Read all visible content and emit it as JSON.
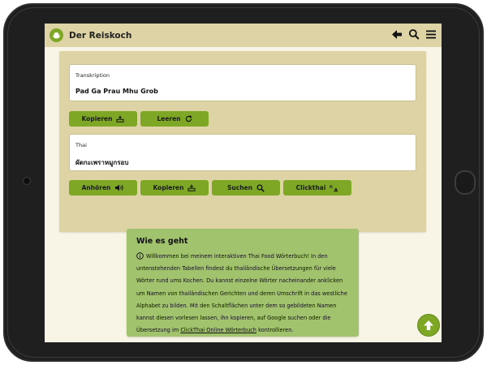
{
  "app": {
    "title": "Der Reiskoch"
  },
  "header_icons": [
    "back-arrow-icon",
    "search-icon",
    "menu-icon"
  ],
  "transcription": {
    "label": "Transkription",
    "value": "Pad Ga Prau Mhu Grob"
  },
  "transcription_buttons": [
    {
      "label": "Kopieren",
      "icon": "copy-icon"
    },
    {
      "label": "Leeren",
      "icon": "refresh-icon"
    }
  ],
  "thai": {
    "label": "Thai",
    "value": "ผัดกะเพราหมูกรอบ"
  },
  "thai_buttons": [
    {
      "label": "Anhören",
      "icon": "speaker-icon"
    },
    {
      "label": "Kopieren",
      "icon": "copy-icon"
    },
    {
      "label": "Suchen",
      "icon": "search-icon"
    },
    {
      "label": "Clickthai",
      "icon": "translate-icon"
    }
  ],
  "info": {
    "title": "Wie es geht",
    "text_before": "Willkommen bei meinem interaktiven Thai Food Wörterbuch! In den untenstehenden Tabellen findest du thailändische Übersetzungen für viele Wörter rund ums Kochen. Du kannst einzelne Wörter nacheinander anklicken um Namen von thailändischen Gerichten und deren Umschrift in das westliche Alphabet zu bilden. Mit den Schaltflächen unter dem so gebildeten Namen kannst diesen vorlesen lassen, ihn kopieren, auf Google suchen oder die Übersetzung im ",
    "link_text": "ClickThai Online Wörterbuch",
    "text_after": " kontrollieren."
  },
  "colors": {
    "accent": "#7ea726",
    "header_bg": "#ddd3a5",
    "info_bg": "#a1c36d",
    "page_bg": "#f8f5e6"
  },
  "scroll_top_icon": "arrow-up-icon"
}
